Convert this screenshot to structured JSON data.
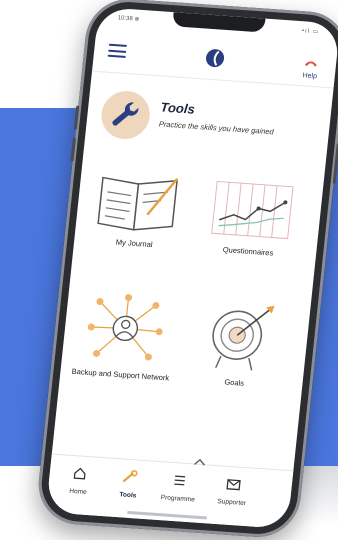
{
  "status_bar": {
    "time": "10:38 ⊗",
    "signal": "•ıl ▭"
  },
  "header": {
    "help_label": "Help"
  },
  "tools": {
    "title": "Tools",
    "subtitle": "Practice the skills you have gained"
  },
  "tiles": [
    {
      "label": "My Journal",
      "icon": "journal-icon"
    },
    {
      "label": "Questionnaires",
      "icon": "chart-icon"
    },
    {
      "label": "Backup and Support Network",
      "icon": "network-icon"
    },
    {
      "label": "Goals",
      "icon": "target-icon"
    }
  ],
  "tabs": [
    {
      "label": "Home",
      "icon": "home-icon",
      "active": false
    },
    {
      "label": "Tools",
      "icon": "wrench-icon",
      "active": true
    },
    {
      "label": "Programme",
      "icon": "list-icon",
      "active": false
    },
    {
      "label": "Supporter",
      "icon": "mail-icon",
      "active": false
    }
  ],
  "colors": {
    "background_band": "#4a76dd",
    "brand_navy": "#2a3e82",
    "help_red": "#d9534f",
    "tool_accent": "#e6a23c"
  }
}
